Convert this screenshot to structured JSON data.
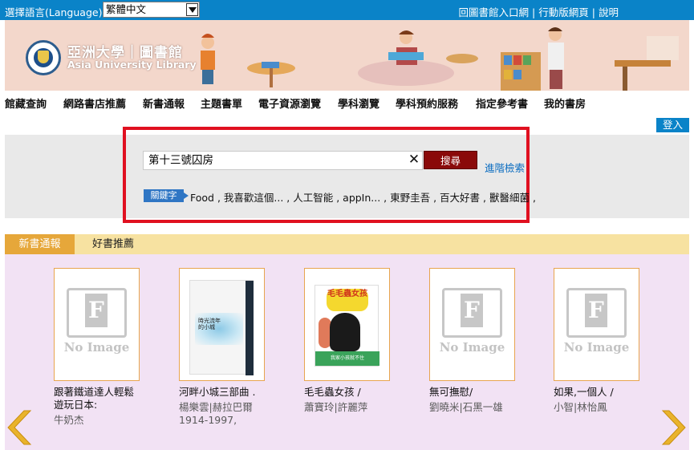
{
  "topbar": {
    "language_label": "選擇語言(Language) :",
    "language_selected": "繁體中文",
    "links": [
      "回圖書館入口網",
      "行動版網頁",
      "說明"
    ]
  },
  "banner": {
    "logo_zh": "亞洲大學｜圖書館",
    "logo_en": "Asia University Library"
  },
  "nav": {
    "items": [
      "館藏查詢",
      "網路書店推薦",
      "新書通報",
      "主題書單",
      "電子資源瀏覽",
      "學科瀏覽",
      "學科預約服務",
      "指定參考書",
      "我的書房"
    ]
  },
  "login_label": "登入",
  "search": {
    "value": "第十三號囚房",
    "button_label": "搜尋",
    "advanced_label": "進階檢索",
    "keyword_badge": "關鍵字",
    "keywords": "Food , 我喜歡這個... , 人工智能 , appIn... , 東野圭吾 , 百大好書 , 獸醫細菌 ,"
  },
  "tabs": {
    "active": "新書通報",
    "inactive": "好書推薦"
  },
  "no_image_label": "No Image",
  "books": [
    {
      "title": "跟著鐵道達人輕鬆遊玩日本:",
      "author": "牛奶杰"
    },
    {
      "title": "河畔小城三部曲 .",
      "author": "楊樂雲|赫拉巴爾 1914-1997,"
    },
    {
      "title": "毛毛蟲女孩 /",
      "author": "蕭寶玲|許麗萍"
    },
    {
      "title": "無可撫慰/",
      "author": "劉曉米|石黑一雄"
    },
    {
      "title": "如果,一個人 /",
      "author": "小智|林怡鳳"
    }
  ],
  "cover_texts": {
    "book2_cover_title": "時光流年的小城",
    "book3_cover_title": "毛毛蟲女孩",
    "book3_cover_bottom": "我家小孩就不住"
  },
  "colors": {
    "topbar": "#0a83c8",
    "search_button": "#8a0a0a",
    "highlight_border": "#e01020",
    "tab_active": "#e6a73a",
    "tab_bar": "#f7e2a1",
    "books_bg": "#f2e2f4",
    "arrow": "#e9b32c"
  },
  "icons": {
    "clear": "close-icon",
    "prev": "chevron-left-icon",
    "next": "chevron-right-icon"
  }
}
